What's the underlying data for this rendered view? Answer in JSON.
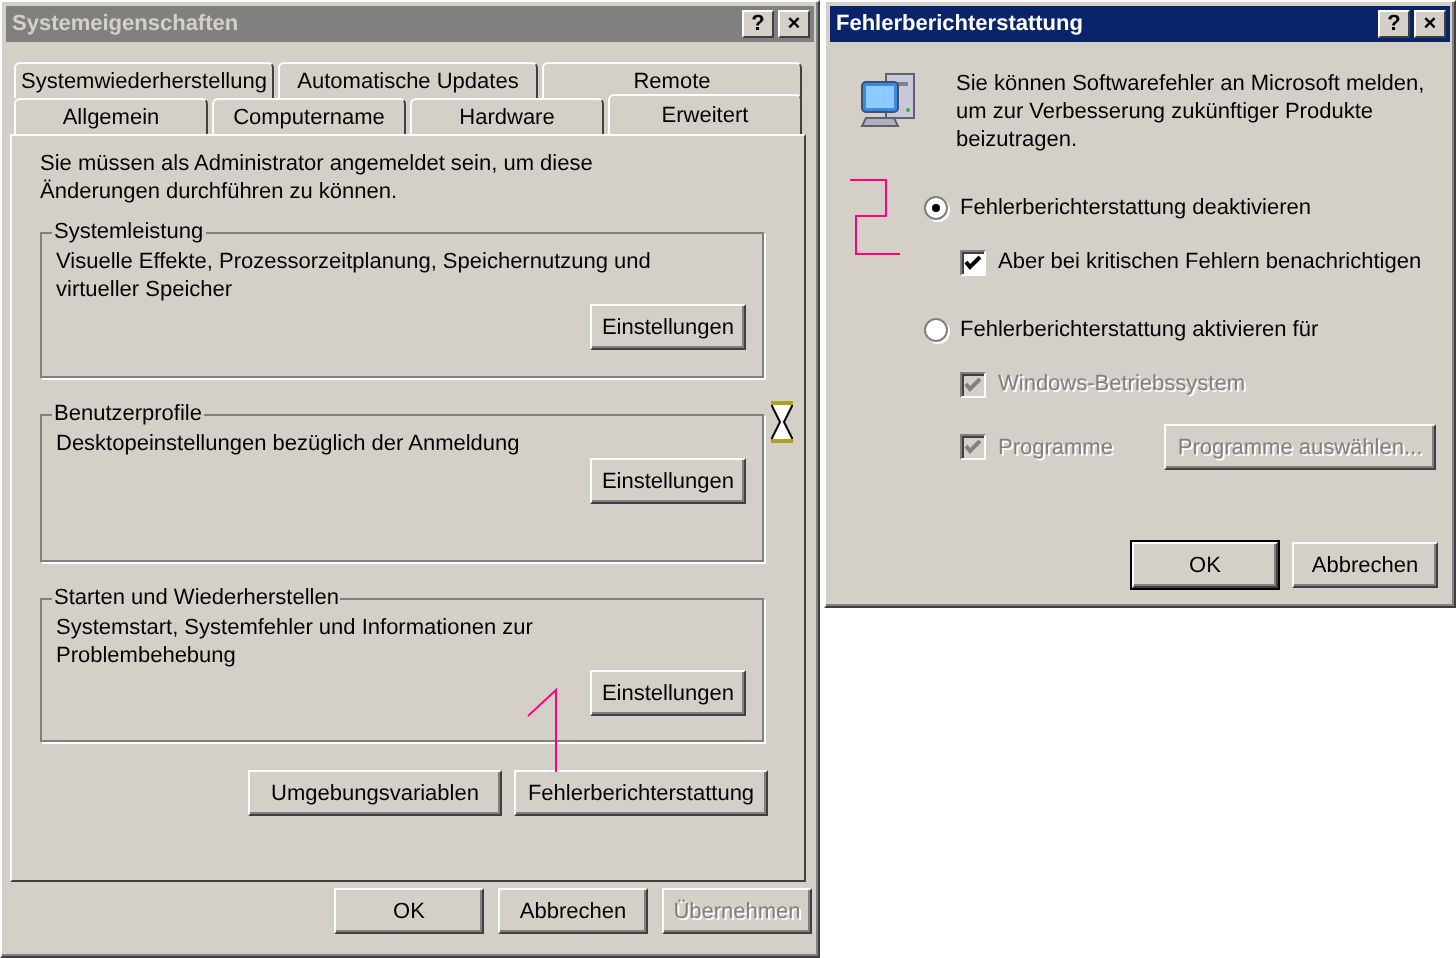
{
  "system_dialog": {
    "title": "Systemeigenschaften",
    "active": false,
    "title_buttons": [
      "?",
      "×"
    ],
    "tab_rows": [
      [
        {
          "label": "Systemwiederherstellung",
          "selected": false
        },
        {
          "label": "Automatische Updates",
          "selected": false
        },
        {
          "label": "Remote",
          "selected": false
        }
      ],
      [
        {
          "label": "Allgemein",
          "selected": false
        },
        {
          "label": "Computername",
          "selected": false
        },
        {
          "label": "Hardware",
          "selected": false
        },
        {
          "label": "Erweitert",
          "selected": true
        }
      ]
    ],
    "notice": "Sie müssen als Administrator angemeldet sein, um diese Änderungen durchführen zu können.",
    "groups": [
      {
        "title": "Systemleistung",
        "description": "Visuelle Effekte, Prozessorzeitplanung, Speichernutzung und virtueller Speicher",
        "button": "Einstellungen"
      },
      {
        "title": "Benutzerprofile",
        "description": "Desktopeinstellungen bezüglich der Anmeldung",
        "button": "Einstellungen"
      },
      {
        "title": "Starten und Wiederherstellen",
        "description": "Systemstart, Systemfehler und Informationen zur Problembehebung",
        "button": "Einstellungen"
      }
    ],
    "extra_buttons": [
      {
        "label": "Umgebungsvariablen",
        "disabled": false
      },
      {
        "label": "Fehlerberichterstattung",
        "disabled": false
      }
    ],
    "footer_buttons": [
      {
        "label": "OK",
        "disabled": false
      },
      {
        "label": "Abbrechen",
        "disabled": false
      },
      {
        "label": "Übernehmen",
        "disabled": true
      }
    ]
  },
  "error_dialog": {
    "title": "Fehlerberichterstattung",
    "active": true,
    "title_buttons": [
      "?",
      "×"
    ],
    "intro": "Sie können Softwarefehler an Microsoft melden, um zur Verbesserung zukünftiger Produkte beizutragen.",
    "options": [
      {
        "label": "Fehlerberichterstattung deaktivieren",
        "selected": true,
        "children": [
          {
            "label": "Aber bei kritischen Fehlern benachrichtigen",
            "checked": true,
            "disabled": false
          }
        ]
      },
      {
        "label": "Fehlerberichterstattung aktivieren für",
        "selected": false,
        "children": [
          {
            "label": "Windows-Betriebssystem",
            "checked": true,
            "disabled": true
          },
          {
            "label": "Programme",
            "checked": true,
            "disabled": true,
            "button": {
              "label": "Programme auswählen...",
              "disabled": true
            }
          }
        ]
      }
    ],
    "footer_buttons": [
      {
        "label": "OK",
        "disabled": false
      },
      {
        "label": "Abbrechen",
        "disabled": false
      }
    ]
  }
}
